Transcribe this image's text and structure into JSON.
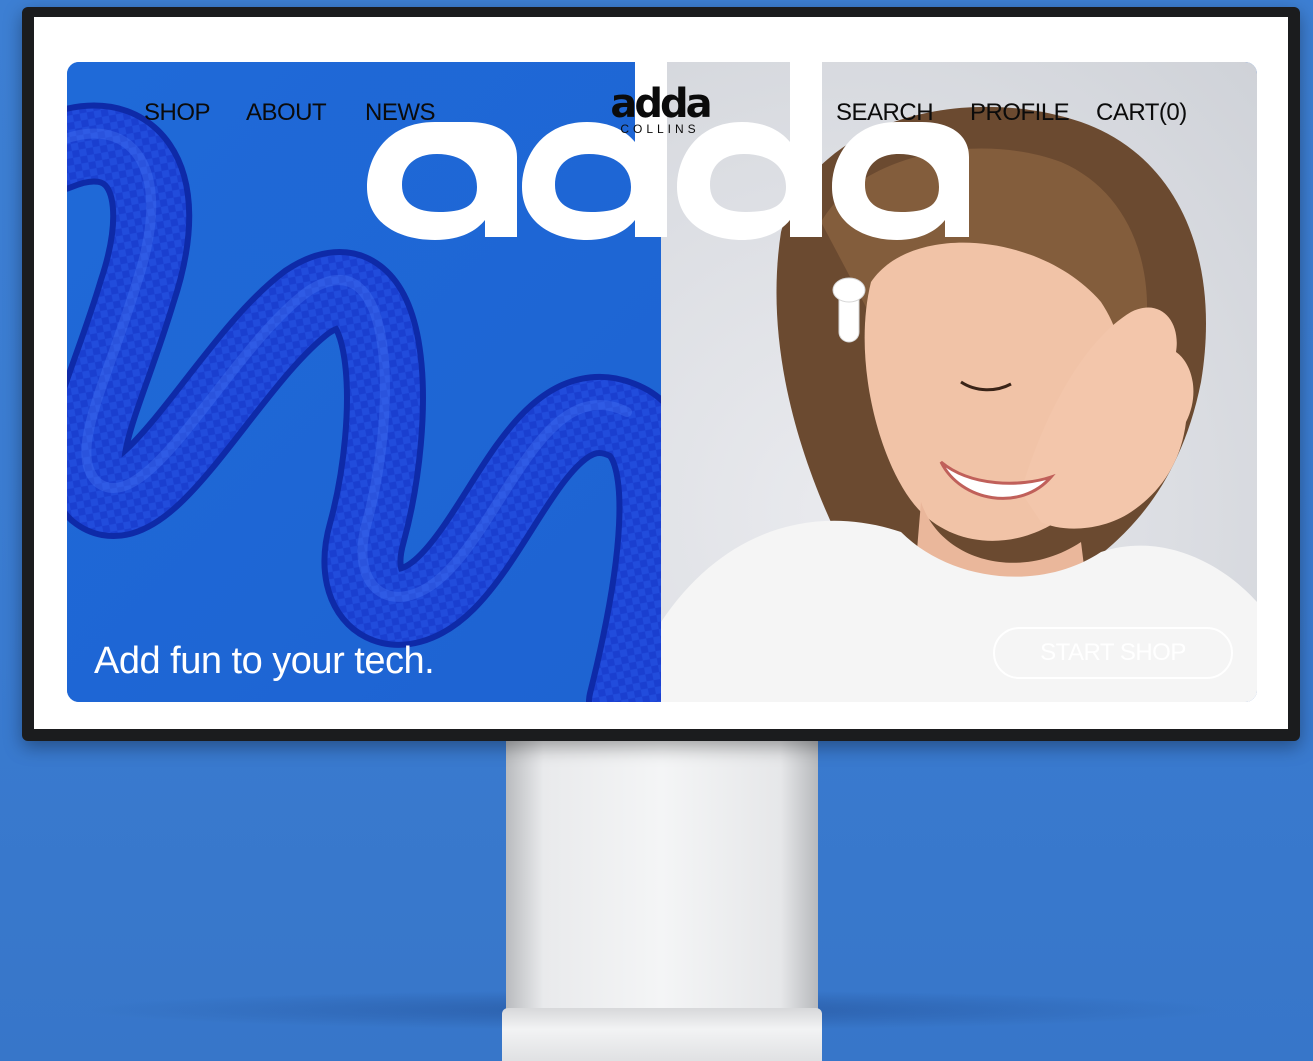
{
  "nav": {
    "left": [
      {
        "label": "SHOP"
      },
      {
        "label": "ABOUT"
      },
      {
        "label": "NEWS"
      }
    ],
    "right": [
      {
        "label": "SEARCH"
      },
      {
        "label": "PROFILE"
      },
      {
        "label": "CART(0)"
      }
    ]
  },
  "brand": {
    "logo_word": "adda",
    "logo_sub": "COLLINS"
  },
  "hero": {
    "tagline": "Add fun to your tech.",
    "cta_label": "START SHOP"
  },
  "colors": {
    "background": "#3a7bd0",
    "hero_blue": "#1f67d4",
    "rope_blue": "#1238c4",
    "text_dark": "#0b0b0b",
    "text_light": "#ffffff"
  }
}
